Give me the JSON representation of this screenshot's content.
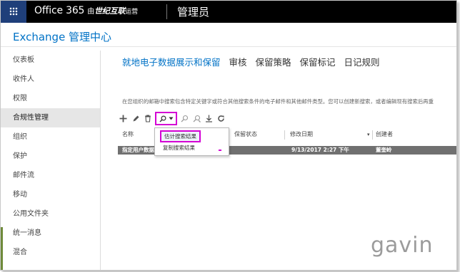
{
  "topbar": {
    "product": "Office 365",
    "by": "由",
    "corp": "世纪互联",
    "operated": "运营",
    "admin_label": "管理员"
  },
  "page_title": "Exchange 管理中心",
  "sidebar": {
    "items": [
      {
        "label": "仪表板"
      },
      {
        "label": "收件人"
      },
      {
        "label": "权限"
      },
      {
        "label": "合规性管理",
        "active": true
      },
      {
        "label": "组织"
      },
      {
        "label": "保护"
      },
      {
        "label": "邮件流"
      },
      {
        "label": "移动"
      },
      {
        "label": "公用文件夹"
      },
      {
        "label": "统一消息"
      },
      {
        "label": "混合"
      }
    ]
  },
  "tabs": [
    {
      "label": "就地电子数据展示和保留",
      "active": true
    },
    {
      "label": "审核"
    },
    {
      "label": "保留策略"
    },
    {
      "label": "保留标记"
    },
    {
      "label": "日记规则"
    }
  ],
  "description": "在您组织的邮箱中搜索包含特定关键字或符合其他搜索条件的电子邮件和其他邮件类型。您可以创建新搜索，或者编辑现有搜索后再重",
  "toolbar": {
    "icons": [
      "add-icon",
      "edit-icon",
      "delete-icon",
      "search-icon",
      "chevron-down-icon",
      "start-search-icon",
      "stop-search-icon",
      "export-icon",
      "refresh-icon"
    ]
  },
  "grid": {
    "headers": {
      "name": "名称",
      "status": "保留状态",
      "modified": "修改日期",
      "creator": "创建者"
    },
    "rows": [
      {
        "name": "指定用户数据",
        "status": "",
        "modified": "9/13/2017 2:27 下午",
        "creator": "董奎岭"
      }
    ]
  },
  "dropdown": {
    "items": [
      {
        "label": "估计搜索结果",
        "highlighted": true
      },
      {
        "label": "复制搜索结果"
      }
    ]
  },
  "watermark": "gavin",
  "colors": {
    "accent": "#0072c6",
    "highlight": "#d400d4",
    "topbar": "#000000",
    "waffle": "#1f3f7a"
  }
}
